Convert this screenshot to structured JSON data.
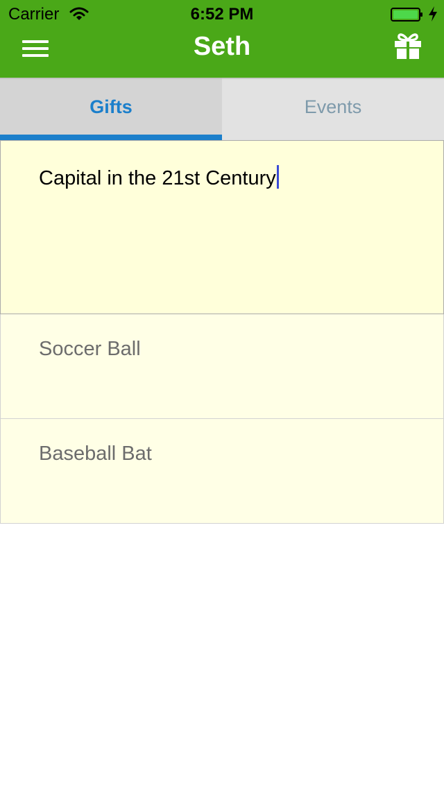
{
  "status_bar": {
    "carrier": "Carrier",
    "time": "6:52 PM"
  },
  "header": {
    "title": "Seth",
    "background_color": "#4aa818",
    "left_icon": "menu-icon",
    "right_icon": "gift-icon"
  },
  "tabs": [
    {
      "label": "Gifts",
      "selected": true
    },
    {
      "label": "Events",
      "selected": false
    }
  ],
  "accent_color": "#1b7fcb",
  "gifts": [
    {
      "text": "Capital in the 21st Century",
      "editing": true
    },
    {
      "text": "Soccer Ball",
      "editing": false
    },
    {
      "text": "Baseball Bat",
      "editing": false
    }
  ]
}
